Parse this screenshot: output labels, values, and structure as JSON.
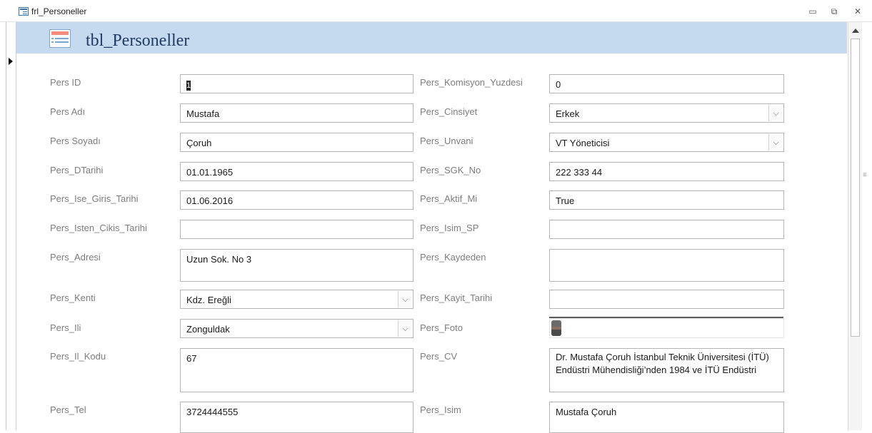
{
  "window": {
    "title": "frl_Personeller",
    "minimize": "▭",
    "restore": "⧉",
    "close": "✕"
  },
  "header": {
    "title": "tbl_Personeller",
    "icon": "form-icon"
  },
  "colors": {
    "header_bg": "#c5d9ef",
    "label": "#7d7d7d",
    "border": "#b5b5b5"
  },
  "left_fields": [
    {
      "label": "Pers ID",
      "value": "1",
      "type": "text"
    },
    {
      "label": "Pers Adı",
      "value": "Mustafa",
      "type": "text"
    },
    {
      "label": "Pers Soyadı",
      "value": "Çoruh",
      "type": "text"
    },
    {
      "label": "Pers_DTarihi",
      "value": "01.01.1965",
      "type": "text"
    },
    {
      "label": "Pers_Ise_Giris_Tarihi",
      "value": "01.06.2016",
      "type": "text"
    },
    {
      "label": "Pers_Isten_Cikis_Tarihi",
      "value": "",
      "type": "text"
    },
    {
      "label": "Pers_Adresi",
      "value": "Uzun Sok. No 3",
      "type": "memo"
    },
    {
      "label": "Pers_Kenti",
      "value": "Kdz. Ereğli",
      "type": "combo"
    },
    {
      "label": "Pers_Ili",
      "value": "Zonguldak",
      "type": "combo"
    },
    {
      "label": "Pers_Il_Kodu",
      "value": "67",
      "type": "memo"
    },
    {
      "label": "Pers_Tel",
      "value": "3724444555",
      "type": "memo"
    }
  ],
  "right_fields": [
    {
      "label": "Pers_Komisyon_Yuzdesi",
      "value": "0",
      "type": "text"
    },
    {
      "label": "Pers_Cinsiyet",
      "value": "Erkek",
      "type": "combo"
    },
    {
      "label": "Pers_Unvani",
      "value": "VT Yöneticisi",
      "type": "combo"
    },
    {
      "label": "Pers_SGK_No",
      "value": "222 333 44",
      "type": "text"
    },
    {
      "label": "Pers_Aktif_Mi",
      "value": "True",
      "type": "text"
    },
    {
      "label": "Pers_Isim_SP",
      "value": "",
      "type": "text"
    },
    {
      "label": "Pers_Kaydeden",
      "value": "",
      "type": "memo"
    },
    {
      "label": "Pers_Kayit_Tarihi",
      "value": "",
      "type": "text"
    },
    {
      "label": "Pers_Foto",
      "value": "",
      "type": "photo"
    },
    {
      "label": "Pers_CV",
      "value": "Dr. Mustafa Çoruh İstanbul Teknik Üniversitesi (İTÜ) Endüstri Mühendisliği’nden 1984 ve İTÜ Endüstri",
      "type": "memo"
    },
    {
      "label": "Pers_Isim",
      "value": "Mustafa Çoruh",
      "type": "memo"
    }
  ]
}
